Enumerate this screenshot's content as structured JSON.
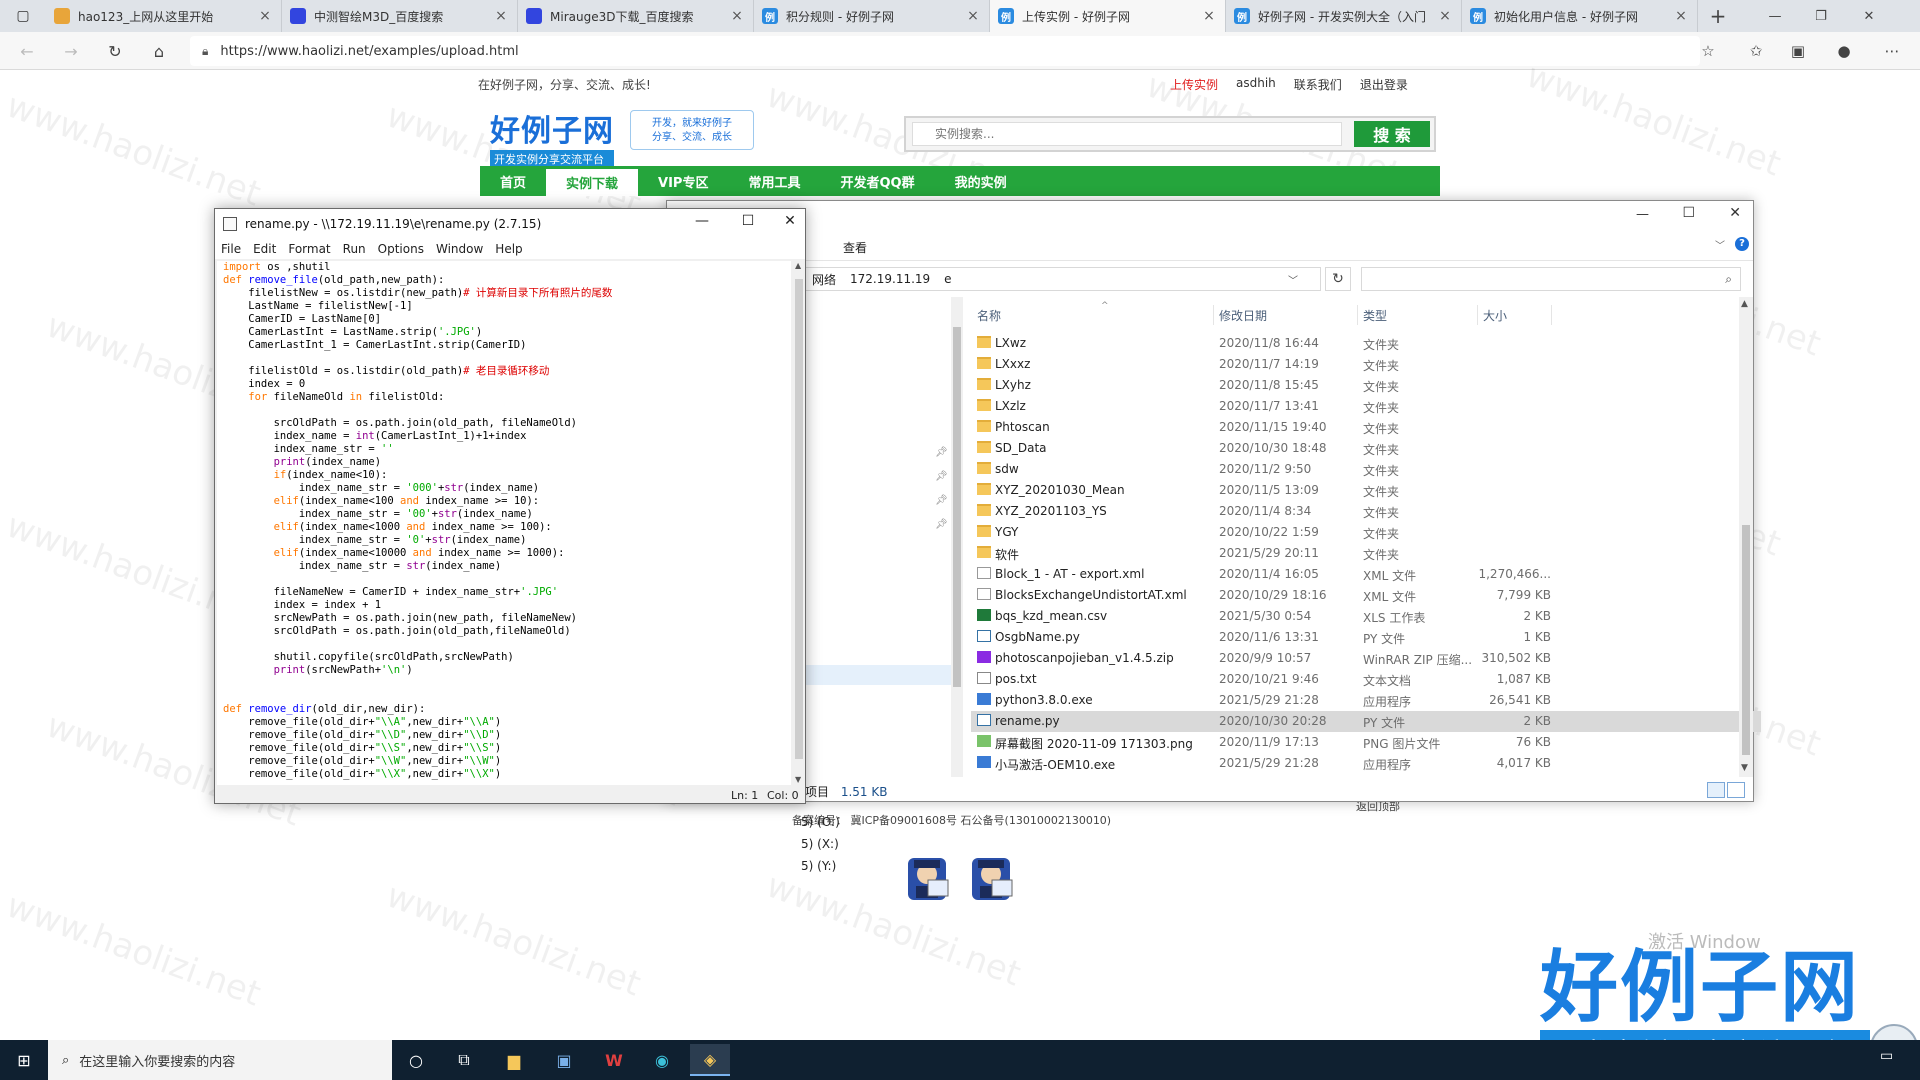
{
  "browser": {
    "tabs": [
      {
        "title": "hao123_上网从这里开始",
        "fav_color": "#e8a53a",
        "fav_icon": "hao123-icon",
        "active": false
      },
      {
        "title": "中测智绘M3D_百度搜索",
        "fav_color": "#3245df",
        "fav_icon": "baidu-paw-icon",
        "active": false
      },
      {
        "title": "Mirauge3D下载_百度搜索",
        "fav_color": "#3245df",
        "fav_icon": "baidu-paw-icon",
        "active": false
      },
      {
        "title": "积分规则 - 好例子网",
        "fav_color": "#2b8be0",
        "fav_icon": "haolizi-icon",
        "active": false
      },
      {
        "title": "上传实例 - 好例子网",
        "fav_color": "#2b8be0",
        "fav_icon": "haolizi-icon",
        "active": true
      },
      {
        "title": "好例子网 - 开发实例大全（入门",
        "fav_color": "#2b8be0",
        "fav_icon": "haolizi-icon",
        "active": false
      },
      {
        "title": "初始化用户信息 - 好例子网",
        "fav_color": "#2b8be0",
        "fav_icon": "haolizi-icon",
        "active": false
      }
    ],
    "fav_letter": "例",
    "url": "https://www.haolizi.net/examples/upload.html"
  },
  "site": {
    "tagline": "在好例子网，分享、交流、成长!",
    "top_links": [
      "上传实例",
      "asdhih",
      "联系我们",
      "退出登录"
    ],
    "logo_text": "好例子网",
    "logo_sub": "开发实例分享交流平台",
    "slogan_line1": "开发，就来好例子",
    "slogan_line2": "分享、交流、成长",
    "search_placeholder": "实例搜索...",
    "search_button": "搜 索",
    "nav": [
      "首页",
      "实例下载",
      "VIP专区",
      "常用工具",
      "开发者QQ群",
      "我的实例"
    ],
    "nav_active": 1,
    "footer_icp": "备案编号：  冀ICP备09001608号  石公备号(13010002130010)",
    "footer_top": "返回顶部",
    "brand_big": "好例子网",
    "brand_sub": "开发实例分享交流平台",
    "watermark": "www.haolizi.net",
    "activate_text": "激活 Window"
  },
  "explorer": {
    "ribbon_view": "查看",
    "path": [
      "网络",
      "172.19.11.19",
      "e"
    ],
    "columns": [
      "名称",
      "修改日期",
      "类型",
      "大小"
    ],
    "drives": [
      "5) (O:)",
      "5) (X:)",
      "5) (Y:)"
    ],
    "status_size": "1.51 KB",
    "status_prefix": "项目",
    "files": [
      {
        "name": "LXwz",
        "date": "2020/11/8 16:44",
        "type": "文件夹",
        "size": "",
        "kind": "folder"
      },
      {
        "name": "LXxxz",
        "date": "2020/11/7 14:19",
        "type": "文件夹",
        "size": "",
        "kind": "folder"
      },
      {
        "name": "LXyhz",
        "date": "2020/11/8 15:45",
        "type": "文件夹",
        "size": "",
        "kind": "folder"
      },
      {
        "name": "LXzlz",
        "date": "2020/11/7 13:41",
        "type": "文件夹",
        "size": "",
        "kind": "folder"
      },
      {
        "name": "Phtoscan",
        "date": "2020/11/15 19:40",
        "type": "文件夹",
        "size": "",
        "kind": "folder"
      },
      {
        "name": "SD_Data",
        "date": "2020/10/30 18:48",
        "type": "文件夹",
        "size": "",
        "kind": "folder"
      },
      {
        "name": "sdw",
        "date": "2020/11/2 9:50",
        "type": "文件夹",
        "size": "",
        "kind": "folder"
      },
      {
        "name": "XYZ_20201030_Mean",
        "date": "2020/11/5 13:09",
        "type": "文件夹",
        "size": "",
        "kind": "folder"
      },
      {
        "name": "XYZ_20201103_YS",
        "date": "2020/11/4 8:34",
        "type": "文件夹",
        "size": "",
        "kind": "folder"
      },
      {
        "name": "YGY",
        "date": "2020/10/22 1:59",
        "type": "文件夹",
        "size": "",
        "kind": "folder"
      },
      {
        "name": "软件",
        "date": "2021/5/29 20:11",
        "type": "文件夹",
        "size": "",
        "kind": "folder"
      },
      {
        "name": "Block_1 - AT - export.xml",
        "date": "2020/11/4 16:05",
        "type": "XML 文件",
        "size": "1,270,466...",
        "kind": "xml"
      },
      {
        "name": "BlocksExchangeUndistortAT.xml",
        "date": "2020/10/29 18:16",
        "type": "XML 文件",
        "size": "7,799 KB",
        "kind": "xml"
      },
      {
        "name": "bqs_kzd_mean.csv",
        "date": "2021/5/30 0:54",
        "type": "XLS 工作表",
        "size": "2 KB",
        "kind": "csv"
      },
      {
        "name": "OsgbName.py",
        "date": "2020/11/6 13:31",
        "type": "PY 文件",
        "size": "1 KB",
        "kind": "py"
      },
      {
        "name": "photoscanpojieban_v1.4.5.zip",
        "date": "2020/9/9 10:57",
        "type": "WinRAR ZIP 压缩...",
        "size": "310,502 KB",
        "kind": "zip"
      },
      {
        "name": "pos.txt",
        "date": "2020/10/21 9:46",
        "type": "文本文档",
        "size": "1,087 KB",
        "kind": "txt"
      },
      {
        "name": "python3.8.0.exe",
        "date": "2021/5/29 21:28",
        "type": "应用程序",
        "size": "26,541 KB",
        "kind": "exe"
      },
      {
        "name": "rename.py",
        "date": "2020/10/30 20:28",
        "type": "PY 文件",
        "size": "2 KB",
        "kind": "py",
        "selected": true
      },
      {
        "name": "屏幕截图 2020-11-09 171303.png",
        "date": "2020/11/9 17:13",
        "type": "PNG 图片文件",
        "size": "76 KB",
        "kind": "png"
      },
      {
        "name": "小马激活-OEM10.exe",
        "date": "2021/5/29 21:28",
        "type": "应用程序",
        "size": "4,017 KB",
        "kind": "exe"
      }
    ]
  },
  "idle": {
    "title": "rename.py - \\\\172.19.11.19\\e\\rename.py (2.7.15)",
    "menu": [
      "File",
      "Edit",
      "Format",
      "Run",
      "Options",
      "Window",
      "Help"
    ],
    "status_ln": "Ln: 1",
    "status_col": "Col: 0",
    "code": [
      "import os ,shutil",
      "def remove_file(old_path,new_path):",
      "    filelistNew = os.listdir(new_path)# 计算新目录下所有照片的尾数",
      "    LastName = filelistNew[-1]",
      "    CamerID = LastName[0]",
      "    CamerLastInt = LastName.strip('.JPG')",
      "    CamerLastInt_1 = CamerLastInt.strip(CamerID)",
      "",
      "    filelistOld = os.listdir(old_path)# 老目录循环移动",
      "    index = 0",
      "    for fileNameOld in filelistOld:",
      "",
      "        srcOldPath = os.path.join(old_path, fileNameOld)",
      "        index_name = int(CamerLastInt_1)+1+index",
      "        index_name_str = ''",
      "        print(index_name)",
      "        if(index_name<10):",
      "            index_name_str = '000'+str(index_name)",
      "        elif(index_name<100 and index_name >= 10):",
      "            index_name_str = '00'+str(index_name)",
      "        elif(index_name<1000 and index_name >= 100):",
      "            index_name_str = '0'+str(index_name)",
      "        elif(index_name<10000 and index_name >= 1000):",
      "            index_name_str = str(index_name)",
      "",
      "        fileNameNew = CamerID + index_name_str+'.JPG'",
      "        index = index + 1",
      "        srcNewPath = os.path.join(new_path, fileNameNew)",
      "        srcOldPath = os.path.join(old_path,fileNameOld)",
      "",
      "        shutil.copyfile(srcOldPath,srcNewPath)",
      "        print(srcNewPath+'\\n')",
      "",
      "",
      "def remove_dir(old_dir,new_dir):",
      "    remove_file(old_dir+\"\\\\A\",new_dir+\"\\\\A\")",
      "    remove_file(old_dir+\"\\\\D\",new_dir+\"\\\\D\")",
      "    remove_file(old_dir+\"\\\\S\",new_dir+\"\\\\S\")",
      "    remove_file(old_dir+\"\\\\W\",new_dir+\"\\\\W\")",
      "    remove_file(old_dir+\"\\\\X\",new_dir+\"\\\\X\")"
    ]
  },
  "taskbar": {
    "search_text": "在这里输入你要搜索的内容"
  }
}
